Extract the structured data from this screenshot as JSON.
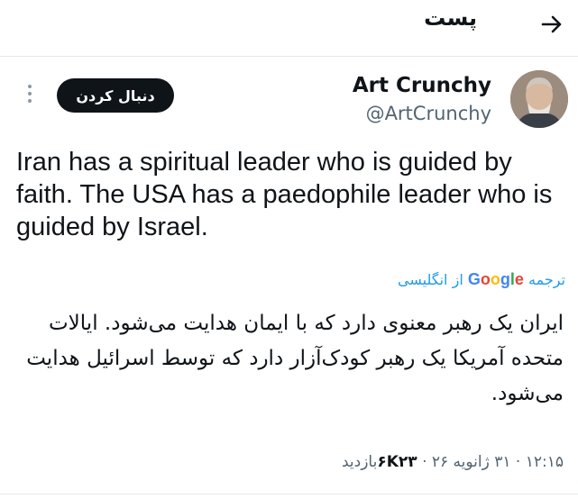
{
  "header": {
    "title": "پست",
    "back_icon": "arrow-right-icon"
  },
  "author": {
    "name": "Art Crunchy",
    "handle": "@ArtCrunchy",
    "follow_label": "دنبال کردن",
    "more_icon": "more-vertical-icon"
  },
  "tweet": {
    "text": "Iran has a spiritual leader who is guided by faith. The USA has a paedophile leader who is guided by Israel.",
    "translate_prefix": "ترجمه",
    "translate_brand": "Google",
    "translate_suffix": "از انگلیسی",
    "translated_text": "ایران یک رهبر معنوی دارد که با ایمان هدایت می‌شود. ایالات متحده آمریکا یک رهبر کودک‌آزار دارد که توسط اسرائیل هدایت می‌شود.",
    "time": "۱۲:۱۵",
    "date": "۳۱ ژانویه ۲۶",
    "views_count": "۶K۲۳",
    "views_label": "بازدید",
    "separator": "·"
  },
  "colors": {
    "link": "#1d9bf0",
    "text": "#0f1419",
    "muted": "#536471",
    "button": "#0f1419"
  }
}
